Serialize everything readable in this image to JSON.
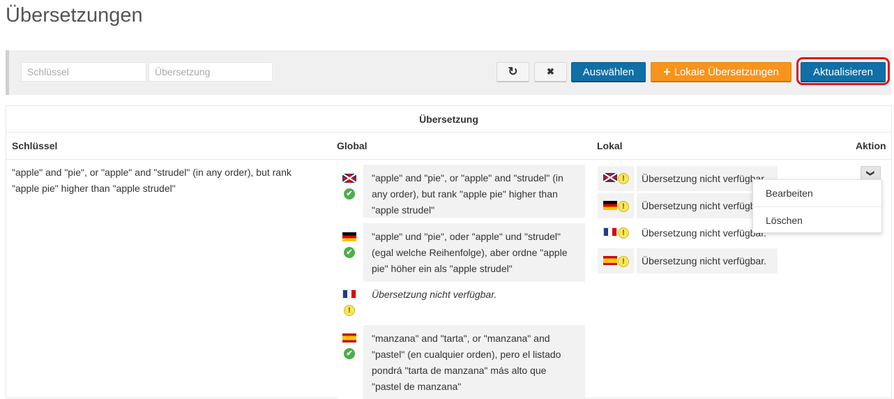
{
  "page": {
    "title": "Übersetzungen"
  },
  "toolbar": {
    "key_placeholder": "Schlüssel",
    "translation_placeholder": "Übersetzung",
    "refresh_icon": "↻",
    "clear_icon": "✖",
    "select_label": "Auswählen",
    "add_local_icon": "+",
    "add_local_label": "Lokale Übersetzungen",
    "update_label": "Aktualisieren"
  },
  "table": {
    "group_header": "Übersetzung",
    "columns": {
      "key": "Schlüssel",
      "global": "Global",
      "local": "Lokal",
      "action": "Aktion"
    },
    "row": {
      "key": "\"apple\" and \"pie\", or \"apple\" and \"strudel\" (in any order), but rank \"apple pie\" higher than \"apple strudel\"",
      "global": [
        {
          "lang": "en",
          "status": "ok",
          "text": "\"apple\" and \"pie\", or \"apple\" and \"strudel\" (in any order), but rank \"apple pie\" higher than \"apple strudel\""
        },
        {
          "lang": "de",
          "status": "ok",
          "text": "\"apple\" und \"pie\", oder \"apple\" und \"strudel\" (egal welche Reihenfolge), aber ordne \"apple pie\" höher ein als \"apple strudel\""
        },
        {
          "lang": "fr",
          "status": "warn",
          "text": "Übersetzung nicht verfügbar."
        },
        {
          "lang": "es",
          "status": "ok",
          "text": "\"manzana\" and \"tarta\", or \"manzana\" and \"pastel\" (en cualquier orden), pero el listado pondrá \"tarta de manzana\" más alto que \"pastel de manzana\""
        }
      ],
      "local": [
        {
          "lang": "en",
          "status": "warn",
          "text": "Übersetzung nicht verfügbar."
        },
        {
          "lang": "de",
          "status": "warn",
          "text": "Übersetzung nicht verfügbar."
        },
        {
          "lang": "fr",
          "status": "warn",
          "text": "Übersetzung nicht verfügbar."
        },
        {
          "lang": "es",
          "status": "warn",
          "text": "Übersetzung nicht verfügbar."
        }
      ]
    },
    "status_icons": {
      "ok": "✔",
      "warn": "!"
    },
    "action": {
      "toggle_icon": "❯",
      "menu": [
        "Bearbeiten",
        "Löschen"
      ]
    }
  },
  "colors": {
    "primary": "#0f6fa6",
    "orange": "#f7941d",
    "highlight": "#e0141e"
  }
}
